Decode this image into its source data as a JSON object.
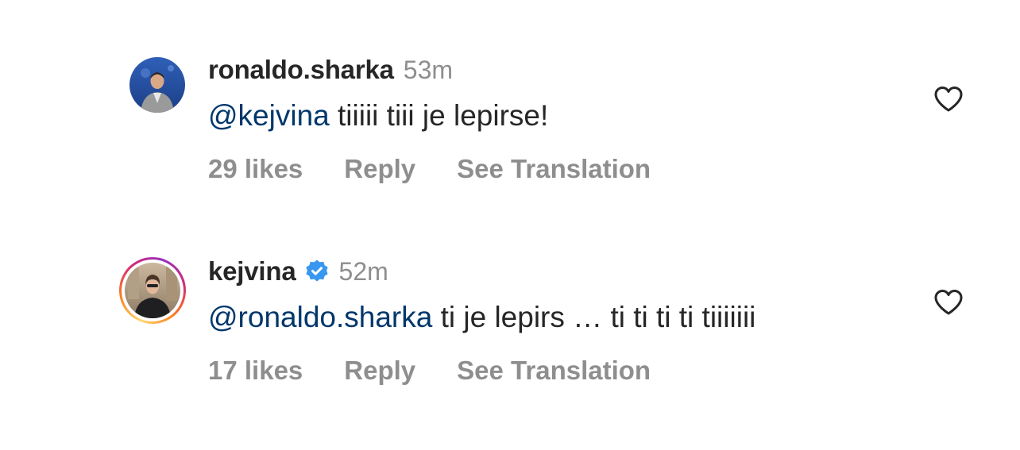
{
  "comments": [
    {
      "username": "ronaldo.sharka",
      "verified": false,
      "time": "53m",
      "mention": "@kejvina",
      "text": " tiiiii tiii je lepirse!",
      "likes": "29 likes",
      "reply_label": "Reply",
      "translate_label": "See Translation"
    },
    {
      "username": "kejvina",
      "verified": true,
      "time": "52m",
      "mention": "@ronaldo.sharka",
      "text": " ti je lepirs … ti ti ti ti tiiiiiii",
      "likes": "17 likes",
      "reply_label": "Reply",
      "translate_label": "See Translation"
    }
  ],
  "colors": {
    "text": "#262626",
    "secondary": "#8e8e8e",
    "mention": "#00376b",
    "verified": "#3897f0"
  },
  "icons": {
    "like": "heart-outline-icon",
    "verified": "verified-badge-icon"
  }
}
